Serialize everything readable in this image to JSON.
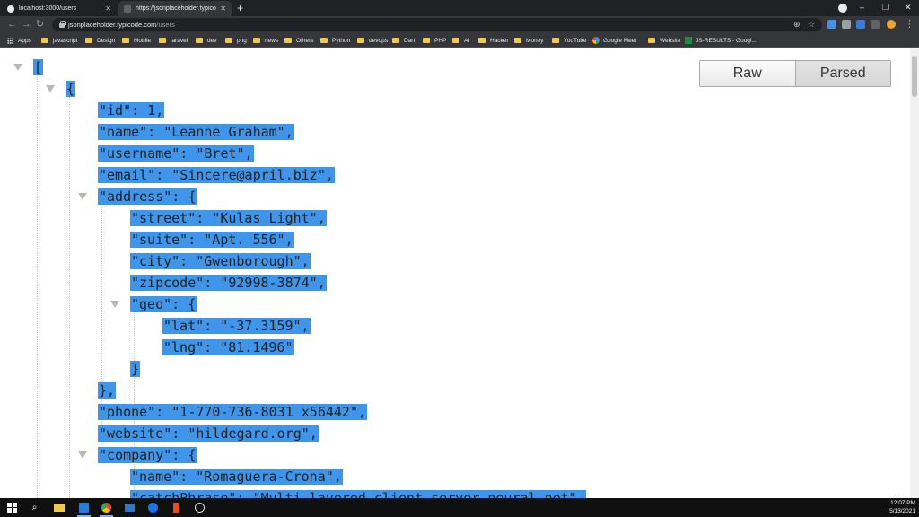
{
  "browser": {
    "tabs": [
      {
        "title": "localhost:3000/users",
        "active": false
      },
      {
        "title": "https://jsonplaceholder.typicode...",
        "active": true
      }
    ],
    "url_host": "jsonplaceholder.typicode.com",
    "url_path": "/users",
    "bookmarks": [
      {
        "label": "Apps",
        "icon": "apps-grid-icon"
      },
      {
        "label": "javascript",
        "icon": "folder-icon"
      },
      {
        "label": "Design",
        "icon": "folder-icon"
      },
      {
        "label": "Mobile",
        "icon": "folder-icon"
      },
      {
        "label": "laravel",
        "icon": "folder-icon"
      },
      {
        "label": "dev",
        "icon": "folder-icon"
      },
      {
        "label": "png",
        "icon": "folder-icon"
      },
      {
        "label": "news",
        "icon": "folder-icon"
      },
      {
        "label": "Others",
        "icon": "folder-icon"
      },
      {
        "label": "Python",
        "icon": "folder-icon"
      },
      {
        "label": "devops",
        "icon": "folder-icon"
      },
      {
        "label": "Dart",
        "icon": "folder-icon"
      },
      {
        "label": "PHP",
        "icon": "folder-icon"
      },
      {
        "label": "AI",
        "icon": "folder-icon"
      },
      {
        "label": "Hacker",
        "icon": "folder-icon"
      },
      {
        "label": "Money",
        "icon": "folder-icon"
      },
      {
        "label": "YouTube",
        "icon": "folder-icon"
      },
      {
        "label": "Google Meet",
        "icon": "google-meet-icon"
      },
      {
        "label": "Website",
        "icon": "folder-icon"
      },
      {
        "label": "JS-RESULTS - Googl...",
        "icon": "sheets-icon"
      }
    ]
  },
  "viewer": {
    "raw_label": "Raw",
    "parsed_label": "Parsed",
    "lines": [
      {
        "level": 0,
        "text": "["
      },
      {
        "level": 1,
        "text": "{"
      },
      {
        "level": 2,
        "text": "\"id\": 1,"
      },
      {
        "level": 2,
        "text": "\"name\": \"Leanne Graham\","
      },
      {
        "level": 2,
        "text": "\"username\": \"Bret\","
      },
      {
        "level": 2,
        "text": "\"email\": \"Sincere@april.biz\","
      },
      {
        "level": 2,
        "text": "\"address\": {"
      },
      {
        "level": 3,
        "text": "\"street\": \"Kulas Light\","
      },
      {
        "level": 3,
        "text": "\"suite\": \"Apt. 556\","
      },
      {
        "level": 3,
        "text": "\"city\": \"Gwenborough\","
      },
      {
        "level": 3,
        "text": "\"zipcode\": \"92998-3874\","
      },
      {
        "level": 3,
        "text": "\"geo\": {"
      },
      {
        "level": 4,
        "text": "\"lat\": \"-37.3159\","
      },
      {
        "level": 4,
        "text": "\"lng\": \"81.1496\""
      },
      {
        "level": 3,
        "text": "}"
      },
      {
        "level": 2,
        "text": "},"
      },
      {
        "level": 2,
        "text": "\"phone\": \"1-770-736-8031 x56442\","
      },
      {
        "level": 2,
        "text": "\"website\": \"hildegard.org\","
      },
      {
        "level": 2,
        "text": "\"company\": {"
      },
      {
        "level": 3,
        "text": "\"name\": \"Romaguera-Crona\","
      },
      {
        "level": 3,
        "text": "\"catchPhrase\": \"Multi-layered client-server neural-net\","
      }
    ]
  },
  "taskbar": {
    "time": "12:07 PM",
    "date": "5/13/2021"
  }
}
